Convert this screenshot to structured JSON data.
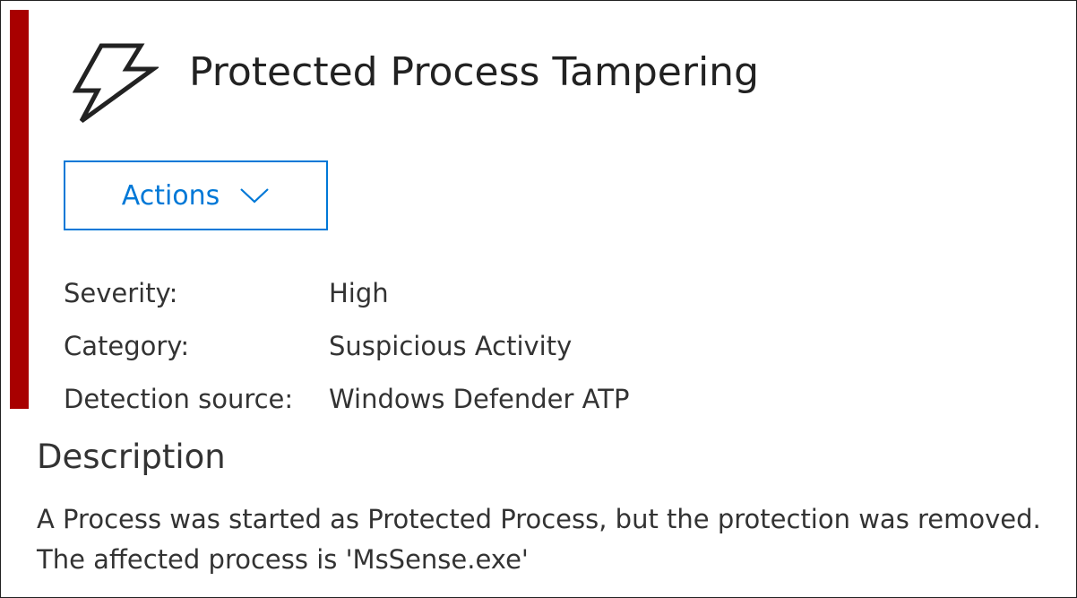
{
  "alert": {
    "title": "Protected Process Tampering",
    "icon": "lightning-bolt-icon",
    "severity_color": "#a80000"
  },
  "actions": {
    "label": "Actions",
    "icon": "chevron-down-icon",
    "accent_color": "#0078d7"
  },
  "properties": [
    {
      "label": "Severity:",
      "value": "High"
    },
    {
      "label": "Category:",
      "value": "Suspicious Activity"
    },
    {
      "label": "Detection source:",
      "value": "Windows Defender ATP"
    }
  ],
  "description": {
    "heading": "Description",
    "lines": [
      "A Process was started as Protected Process, but the protection was removed.",
      "The affected process is 'MsSense.exe'"
    ]
  }
}
